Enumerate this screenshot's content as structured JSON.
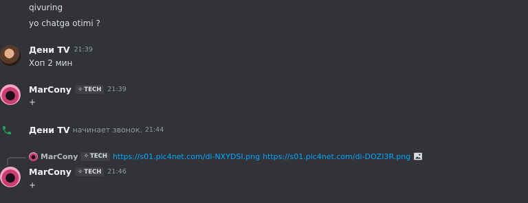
{
  "messages": {
    "m1_line1": "qivuring",
    "m1_line2": "yo chatga otimi  ?",
    "deni": {
      "username": "Дени TV",
      "time": "21:39",
      "text": "Хоп 2 мин"
    },
    "marcony1": {
      "username": "MarCony",
      "tag": "TECH",
      "time": "21:39",
      "text": "+"
    },
    "call": {
      "username": "Дени TV",
      "action": "начинает звонок.",
      "time": "21:44"
    },
    "reply": {
      "username": "MarCony",
      "tag": "TECH",
      "link1": "https://s01.pic4net.com/di-NXYDSI.png",
      "link2": "https://s01.pic4net.com/di-DOZI3R.png"
    },
    "marcony2": {
      "username": "MarCony",
      "tag": "TECH",
      "time": "21:46",
      "text": "+"
    }
  },
  "colors": {
    "background": "#313338",
    "link": "#00a8fc",
    "call_icon": "#23a55a"
  },
  "icons": {
    "call": "phone-icon",
    "image": "image-icon",
    "tag_glyph": "sparkle-icon"
  }
}
